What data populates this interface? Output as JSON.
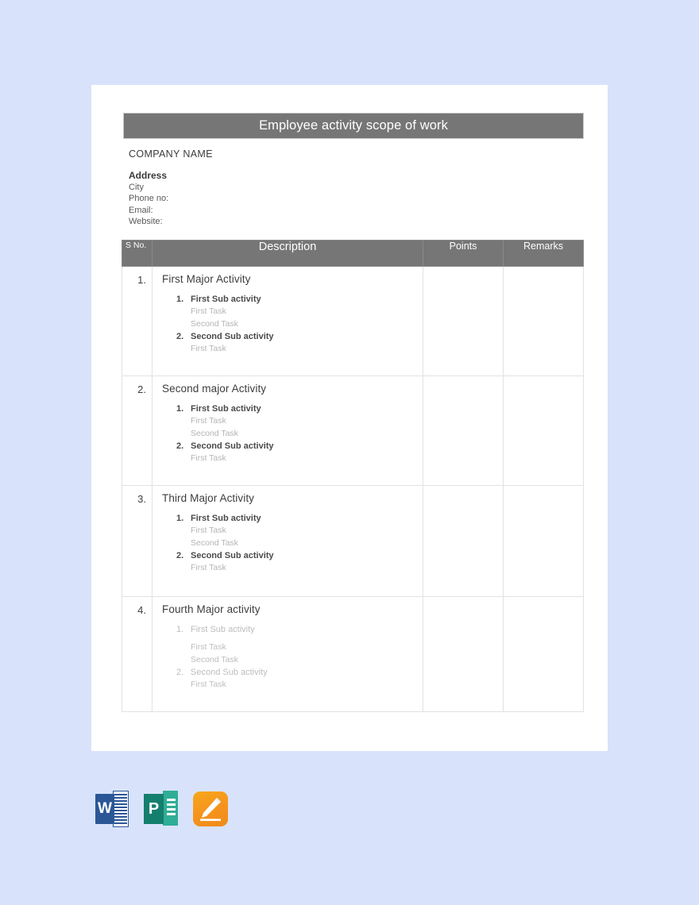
{
  "document": {
    "title": "Employee activity scope of work",
    "company": {
      "name": "COMPANY NAME",
      "address": "Address",
      "lines": [
        "City",
        "Phone no:",
        "Email:",
        "Website:"
      ]
    },
    "table": {
      "headers": {
        "sno": "S No.",
        "description": "Description",
        "points": "Points",
        "remarks": "Remarks"
      },
      "rows": [
        {
          "sno": "1.",
          "title": "First Major Activity",
          "subs": [
            {
              "num": "1.",
              "label": "First Sub activity",
              "tasks": [
                "First Task",
                "Second Task"
              ]
            },
            {
              "num": "2.",
              "label": "Second Sub activity",
              "tasks": [
                "First Task"
              ]
            }
          ],
          "points": "",
          "remarks": ""
        },
        {
          "sno": "2.",
          "title": "Second major Activity",
          "subs": [
            {
              "num": "1.",
              "label": "First Sub activity",
              "tasks": [
                "First Task",
                "Second Task"
              ]
            },
            {
              "num": "2.",
              "label": "Second Sub activity",
              "tasks": [
                "First Task"
              ]
            }
          ],
          "points": "",
          "remarks": ""
        },
        {
          "sno": "3.",
          "title": "Third Major Activity",
          "subs": [
            {
              "num": "1.",
              "label": "First Sub activity",
              "tasks": [
                "First Task",
                "Second Task"
              ]
            },
            {
              "num": "2.",
              "label": "Second Sub activity",
              "tasks": [
                "First Task"
              ]
            }
          ],
          "points": "",
          "remarks": ""
        },
        {
          "sno": "4.",
          "title": "Fourth Major activity",
          "subs": [
            {
              "num": "1.",
              "label": "First Sub activity",
              "tasks": [
                "First Task",
                "Second Task"
              ]
            },
            {
              "num": "2.",
              "label": "Second Sub activity",
              "tasks": [
                "First Task"
              ]
            }
          ],
          "points": "",
          "remarks": ""
        }
      ]
    }
  },
  "app_icons": [
    {
      "name": "microsoft-word-icon",
      "letter": "W",
      "color": "#2b5797"
    },
    {
      "name": "microsoft-publisher-icon",
      "letter": "P",
      "color": "#157f6e"
    },
    {
      "name": "apple-pages-icon",
      "letter": "",
      "color": "#f5931d"
    }
  ],
  "colors": {
    "background": "#d8e3fb",
    "sheet": "#ffffff",
    "banner": "#767676",
    "header_gray": "#767676",
    "border": "#e2e2e2",
    "task_text": "#b4b4b4"
  }
}
